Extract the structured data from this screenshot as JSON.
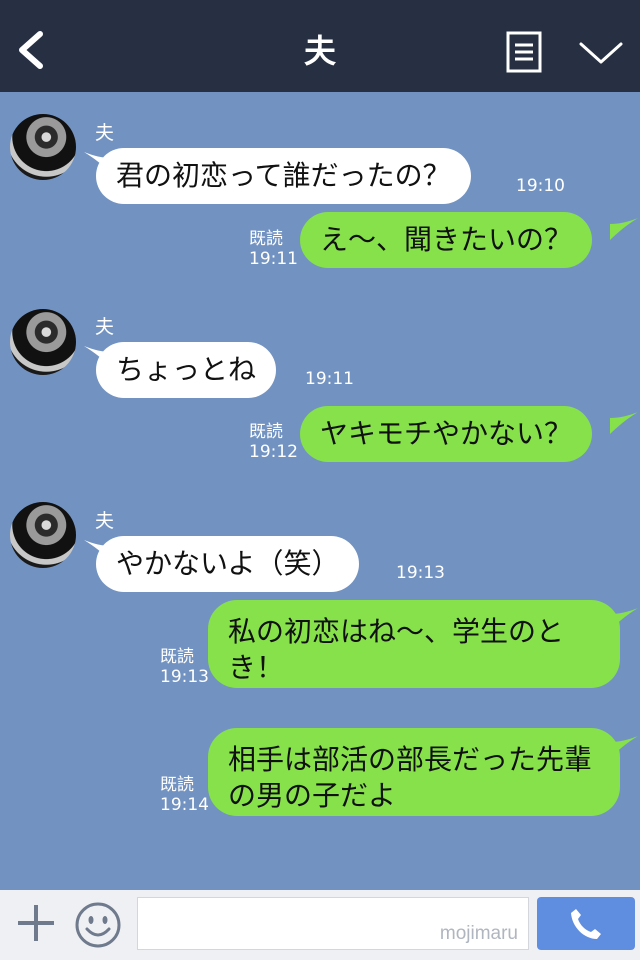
{
  "header": {
    "title": "夫"
  },
  "messages": [
    {
      "side": "in",
      "sender": "夫",
      "text": "君の初恋って誰だったの？",
      "time": "19:10"
    },
    {
      "side": "out",
      "read": "既読",
      "text": "え〜、聞きたいの？",
      "time": "19:11"
    },
    {
      "side": "in",
      "sender": "夫",
      "text": "ちょっとね",
      "time": "19:11"
    },
    {
      "side": "out",
      "read": "既読",
      "text": "ヤキモチやかない？",
      "time": "19:12"
    },
    {
      "side": "in",
      "sender": "夫",
      "text": "やかないよ（笑）",
      "time": "19:13"
    },
    {
      "side": "out",
      "read": "既読",
      "text": "私の初恋はね〜、学生のとき！",
      "time": "19:13"
    },
    {
      "side": "out",
      "read": "既読",
      "text": "相手は部活の部長だった先輩の男の子だよ",
      "time": "19:14"
    }
  ],
  "input": {
    "watermark": "mojimaru"
  },
  "icons": {
    "back": "chevron-left-icon",
    "menu": "notes-icon",
    "collapse": "chevron-down-icon",
    "add": "plus-icon",
    "sticker": "smiley-icon",
    "call": "phone-icon"
  },
  "colors": {
    "header_bg": "#263042",
    "chat_bg": "#7293c1",
    "incoming_bubble": "#ffffff",
    "outgoing_bubble": "#86e14a",
    "call_button": "#5f8ee0"
  }
}
